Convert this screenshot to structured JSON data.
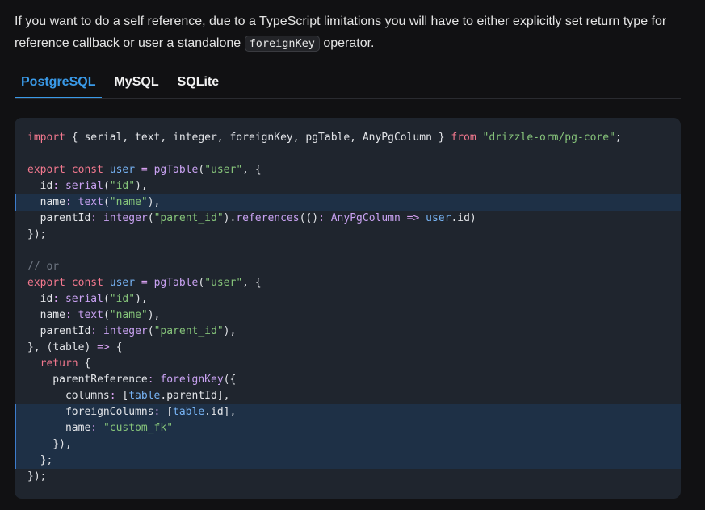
{
  "intro": {
    "text_before": "If you want to do a self reference, due to a TypeScript limitations you will have to either explicitly set return type for reference callback or user a standalone ",
    "inline_code": "foreignKey",
    "text_after": " operator."
  },
  "tabs": [
    {
      "label": "PostgreSQL",
      "active": true
    },
    {
      "label": "MySQL",
      "active": false
    },
    {
      "label": "SQLite",
      "active": false
    }
  ],
  "code": {
    "language": "typescript",
    "highlighted_lines": [
      4,
      17,
      18,
      19,
      20
    ],
    "lines": [
      [
        [
          "kw",
          "import"
        ],
        [
          "p",
          " { serial, text, integer, foreignKey, pgTable, AnyPgColumn } "
        ],
        [
          "kw",
          "from"
        ],
        [
          "p",
          " "
        ],
        [
          "str",
          "\"drizzle-orm/pg-core\""
        ],
        [
          "p",
          ";"
        ]
      ],
      [],
      [
        [
          "kw",
          "export"
        ],
        [
          "p",
          " "
        ],
        [
          "kw",
          "const"
        ],
        [
          "p",
          " "
        ],
        [
          "vr",
          "user"
        ],
        [
          "p",
          " "
        ],
        [
          "op",
          "="
        ],
        [
          "p",
          " "
        ],
        [
          "fn",
          "pgTable"
        ],
        [
          "p",
          "("
        ],
        [
          "str",
          "\"user\""
        ],
        [
          "p",
          ", {"
        ]
      ],
      [
        [
          "p",
          "  id"
        ],
        [
          "op",
          ":"
        ],
        [
          "p",
          " "
        ],
        [
          "fn",
          "serial"
        ],
        [
          "p",
          "("
        ],
        [
          "str",
          "\"id\""
        ],
        [
          "p",
          "),"
        ]
      ],
      [
        [
          "p",
          "  name"
        ],
        [
          "op",
          ":"
        ],
        [
          "p",
          " "
        ],
        [
          "fn",
          "text"
        ],
        [
          "p",
          "("
        ],
        [
          "str",
          "\"name\""
        ],
        [
          "p",
          "),"
        ]
      ],
      [
        [
          "p",
          "  parentId"
        ],
        [
          "op",
          ":"
        ],
        [
          "p",
          " "
        ],
        [
          "fn",
          "integer"
        ],
        [
          "p",
          "("
        ],
        [
          "str",
          "\"parent_id\""
        ],
        [
          "p",
          ")."
        ],
        [
          "fn",
          "references"
        ],
        [
          "p",
          "(()"
        ],
        [
          "op",
          ":"
        ],
        [
          "p",
          " "
        ],
        [
          "fn",
          "AnyPgColumn"
        ],
        [
          "p",
          " "
        ],
        [
          "op",
          "=>"
        ],
        [
          "p",
          " "
        ],
        [
          "vr",
          "user"
        ],
        [
          "p",
          ".id)"
        ]
      ],
      [
        [
          "p",
          "});"
        ]
      ],
      [],
      [
        [
          "cm",
          "// or"
        ]
      ],
      [
        [
          "kw",
          "export"
        ],
        [
          "p",
          " "
        ],
        [
          "kw",
          "const"
        ],
        [
          "p",
          " "
        ],
        [
          "vr",
          "user"
        ],
        [
          "p",
          " "
        ],
        [
          "op",
          "="
        ],
        [
          "p",
          " "
        ],
        [
          "fn",
          "pgTable"
        ],
        [
          "p",
          "("
        ],
        [
          "str",
          "\"user\""
        ],
        [
          "p",
          ", {"
        ]
      ],
      [
        [
          "p",
          "  id"
        ],
        [
          "op",
          ":"
        ],
        [
          "p",
          " "
        ],
        [
          "fn",
          "serial"
        ],
        [
          "p",
          "("
        ],
        [
          "str",
          "\"id\""
        ],
        [
          "p",
          "),"
        ]
      ],
      [
        [
          "p",
          "  name"
        ],
        [
          "op",
          ":"
        ],
        [
          "p",
          " "
        ],
        [
          "fn",
          "text"
        ],
        [
          "p",
          "("
        ],
        [
          "str",
          "\"name\""
        ],
        [
          "p",
          "),"
        ]
      ],
      [
        [
          "p",
          "  parentId"
        ],
        [
          "op",
          ":"
        ],
        [
          "p",
          " "
        ],
        [
          "fn",
          "integer"
        ],
        [
          "p",
          "("
        ],
        [
          "str",
          "\"parent_id\""
        ],
        [
          "p",
          "),"
        ]
      ],
      [
        [
          "p",
          "}, ("
        ],
        [
          "p",
          "table"
        ],
        [
          "p",
          ") "
        ],
        [
          "op",
          "=>"
        ],
        [
          "p",
          " {"
        ]
      ],
      [
        [
          "p",
          "  "
        ],
        [
          "kw",
          "return"
        ],
        [
          "p",
          " {"
        ]
      ],
      [
        [
          "p",
          "    parentReference"
        ],
        [
          "op",
          ":"
        ],
        [
          "p",
          " "
        ],
        [
          "fn",
          "foreignKey"
        ],
        [
          "p",
          "({"
        ]
      ],
      [
        [
          "p",
          "      columns"
        ],
        [
          "op",
          ":"
        ],
        [
          "p",
          " ["
        ],
        [
          "vr",
          "table"
        ],
        [
          "p",
          ".parentId],"
        ]
      ],
      [
        [
          "p",
          "      foreignColumns"
        ],
        [
          "op",
          ":"
        ],
        [
          "p",
          " ["
        ],
        [
          "vr",
          "table"
        ],
        [
          "p",
          ".id],"
        ]
      ],
      [
        [
          "p",
          "      name"
        ],
        [
          "op",
          ":"
        ],
        [
          "p",
          " "
        ],
        [
          "str",
          "\"custom_fk\""
        ]
      ],
      [
        [
          "p",
          "    }),"
        ]
      ],
      [
        [
          "p",
          "  };"
        ]
      ],
      [
        [
          "p",
          "});"
        ]
      ]
    ]
  },
  "colors": {
    "accent": "#3a9ae8",
    "keyword": "#f2788e",
    "function": "#c9a2f2",
    "string": "#86c47a",
    "variable": "#77b3f4",
    "comment": "#6f7783",
    "code_background": "#1f252e",
    "highlight_background": "#1e3046"
  }
}
